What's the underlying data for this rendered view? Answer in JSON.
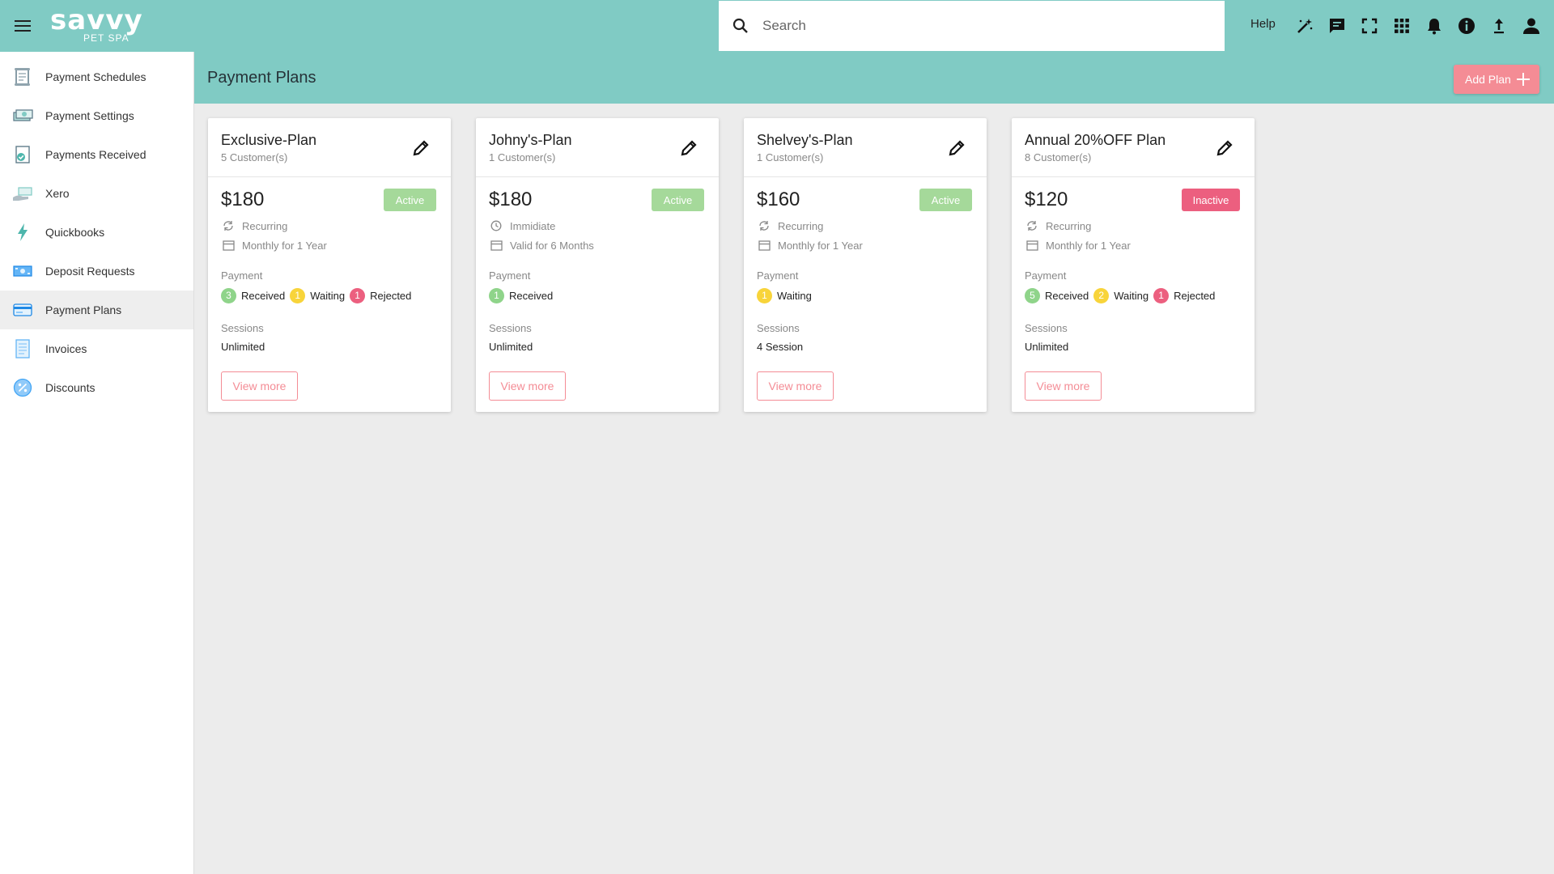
{
  "app": {
    "logo_main": "savvy",
    "logo_sub": "PET SPA"
  },
  "topbar": {
    "search_placeholder": "Search",
    "help_label": "Help",
    "icons": [
      "magic-wand-icon",
      "chat-icon",
      "fullscreen-icon",
      "apps-grid-icon",
      "bell-icon",
      "info-icon",
      "upload-icon",
      "account-icon"
    ]
  },
  "sidebar": {
    "items": [
      {
        "label": "Payment Schedules",
        "icon": "scroll-icon"
      },
      {
        "label": "Payment Settings",
        "icon": "cash-settings-icon"
      },
      {
        "label": "Payments Received",
        "icon": "receipt-check-icon"
      },
      {
        "label": "Xero",
        "icon": "money-hand-icon"
      },
      {
        "label": "Quickbooks",
        "icon": "lightning-icon"
      },
      {
        "label": "Deposit Requests",
        "icon": "banknote-icon"
      },
      {
        "label": "Payment Plans",
        "icon": "credit-card-icon",
        "active": true
      },
      {
        "label": "Invoices",
        "icon": "invoice-icon"
      },
      {
        "label": "Discounts",
        "icon": "percent-badge-icon"
      }
    ]
  },
  "page": {
    "title": "Payment Plans",
    "add_button": "Add Plan"
  },
  "labels": {
    "payment": "Payment",
    "sessions": "Sessions",
    "view_more": "View more",
    "received": "Received",
    "waiting": "Waiting",
    "rejected": "Rejected"
  },
  "plans": [
    {
      "name": "Exclusive-Plan",
      "customers": "5 Customer(s)",
      "price": "$180",
      "status": "Active",
      "type": "Recurring",
      "duration": "Monthly for 1 Year",
      "received": "3",
      "waiting": "1",
      "rejected": "1",
      "sessions": "Unlimited"
    },
    {
      "name": "Johny's-Plan",
      "customers": "1 Customer(s)",
      "price": "$180",
      "status": "Active",
      "type": "Immidiate",
      "duration": "Valid for 6 Months",
      "received": "1",
      "sessions": "Unlimited"
    },
    {
      "name": "Shelvey's-Plan",
      "customers": "1 Customer(s)",
      "price": "$160",
      "status": "Active",
      "type": "Recurring",
      "duration": "Monthly for 1 Year",
      "waiting": "1",
      "sessions": "4 Session"
    },
    {
      "name": "Annual 20%OFF Plan",
      "customers": "8 Customer(s)",
      "price": "$120",
      "status": "Inactive",
      "type": "Recurring",
      "duration": "Monthly for 1 Year",
      "received": "5",
      "waiting": "2",
      "rejected": "1",
      "sessions": "Unlimited"
    }
  ],
  "colors": {
    "header": "#80cbc4",
    "accent": "#f48c95",
    "active": "#a5d99a",
    "inactive": "#ec5f7f",
    "received": "#8fd48a",
    "waiting": "#f8d43a",
    "rejected": "#ec5f7f"
  }
}
